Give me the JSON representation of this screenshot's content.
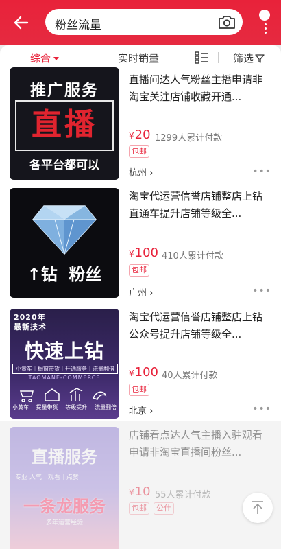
{
  "header": {
    "search_query": "粉丝流量",
    "icons": [
      "back-arrow-icon",
      "camera-icon",
      "more-icon"
    ]
  },
  "filter_bar": {
    "tabs": [
      "综合",
      "实时销量",
      "筛选"
    ],
    "icons": [
      "list-view-icon",
      "filter-funnel-icon"
    ]
  },
  "products": [
    {
      "title": "直播间达人气粉丝主播申请非淘宝关注店铺收藏开通...",
      "price": "20",
      "currency": "¥",
      "sold": "1299人累计付款",
      "tag": "包邮",
      "location": "杭州 ›",
      "thumb": {
        "line1": "推广服务",
        "line2": "直播",
        "line3": "各平台都可以"
      }
    },
    {
      "title": "淘宝代运营信誉店铺整店上钻直通车提升店铺等级全...",
      "price": "100",
      "currency": "¥",
      "sold": "410人累计付款",
      "tag": "包邮",
      "location": "广州 ›",
      "thumb": {
        "line1": "↑钻  粉丝"
      }
    },
    {
      "title": "淘宝代运营信誉店铺整店上钻公众号提升店铺等级全...",
      "price": "100",
      "currency": "¥",
      "sold": "40人累计付款",
      "tag": "包邮",
      "location": "北京 ›",
      "thumb": {
        "year": "2020年",
        "sub": "最新技术",
        "line1": "快速上钻",
        "row": "小黄车｜橱窗带货｜开通服务｜流量翻倍",
        "brand": "TAOMANE-COMMERCE",
        "features": [
          "小黄车",
          "提量带货",
          "等级提升",
          "流量翻倍"
        ]
      }
    },
    {
      "title": "店铺看点达人气主播入驻观看申请非淘宝直播间粉丝...",
      "price": "10",
      "currency": "¥",
      "sold": "55人累计付款",
      "tag": "包邮",
      "tag2": "公仕",
      "thumb": {
        "line1": "直播服务",
        "tags": "专业  人气｜观看｜点赞",
        "line2": "一条龙服务",
        "footer": "多年运营经验"
      }
    }
  ]
}
